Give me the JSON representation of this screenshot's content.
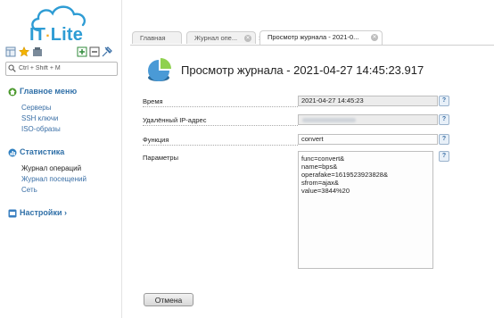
{
  "logo": {
    "text_a": "IT",
    "text_b": "Lite"
  },
  "search": {
    "placeholder": "Ctrl + Shift + M"
  },
  "sidebar": {
    "main_menu": {
      "label": "Главное меню",
      "items": [
        "Серверы",
        "SSH ключи",
        "ISO-образы"
      ]
    },
    "stats": {
      "label": "Статистика",
      "items": [
        "Журнал операций",
        "Журнал посещений",
        "Сеть"
      ]
    },
    "settings": {
      "label": "Настройки ›"
    }
  },
  "tabs": [
    {
      "label": "Главная"
    },
    {
      "label": "Журнал опе..."
    },
    {
      "label": "Просмотр журнала - 2021-0..."
    }
  ],
  "tab_arrow": "›",
  "page": {
    "title": "Просмотр журнала - 2021-04-27 14:45:23.917",
    "fields": {
      "time": {
        "label": "Время",
        "value": "2021-04-27 14:45:23"
      },
      "ip": {
        "label": "Удалённый IP-адрес"
      },
      "function": {
        "label": "Функция",
        "value": "convert"
      },
      "params": {
        "label": "Параметры",
        "value": "func=convert&\nname=bps&\noperafake=1619523923828&\nsfrom=ajax&\nvalue=3844%20"
      }
    },
    "help_glyph": "?",
    "cancel_label": "Отмена"
  },
  "colors": {
    "accent": "#2e9cd4",
    "link": "#3a6fa6",
    "logo_dot": "#f4a71b"
  }
}
